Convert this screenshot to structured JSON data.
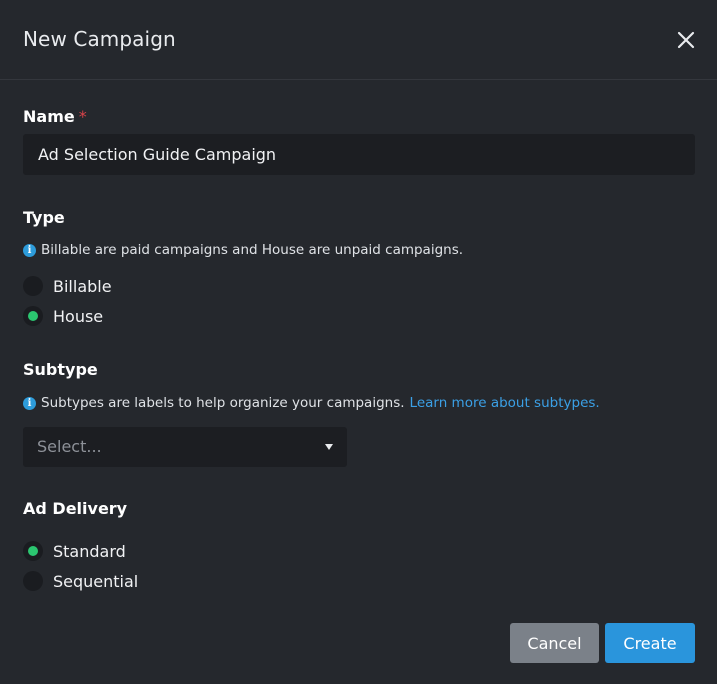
{
  "dialog": {
    "title": "New Campaign",
    "close_icon": "close-icon"
  },
  "name_field": {
    "label": "Name",
    "required_marker": "*",
    "value": "Ad Selection Guide Campaign"
  },
  "type_field": {
    "label": "Type",
    "hint": "Billable are paid campaigns and House are unpaid campaigns.",
    "options": [
      {
        "label": "Billable",
        "selected": false
      },
      {
        "label": "House",
        "selected": true
      }
    ]
  },
  "subtype_field": {
    "label": "Subtype",
    "hint": "Subtypes are labels to help organize your campaigns.",
    "link_text": "Learn more about subtypes.",
    "placeholder": "Select..."
  },
  "delivery_field": {
    "label": "Ad Delivery",
    "options": [
      {
        "label": "Standard",
        "selected": true
      },
      {
        "label": "Sequential",
        "selected": false
      }
    ]
  },
  "footer": {
    "cancel_label": "Cancel",
    "create_label": "Create"
  },
  "colors": {
    "background": "#25282d",
    "input_background": "#1c1e22",
    "accent_blue": "#2a95dc",
    "radio_selected": "#2bc670",
    "required_red": "#d9434a",
    "cancel_gray": "#7b8189"
  }
}
